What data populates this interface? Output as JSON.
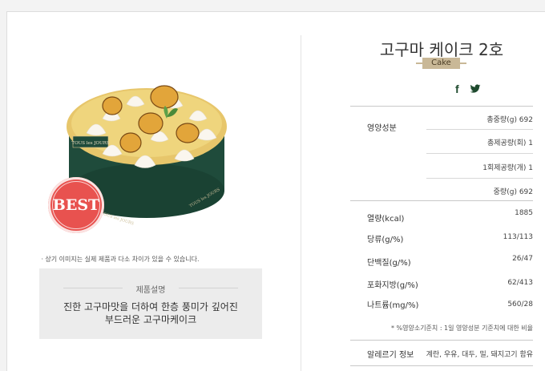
{
  "product": {
    "name": "고구마 케이크 2호",
    "category": "Cake",
    "badge": "BEST",
    "brand_box": "TOUS les JOURS",
    "image_notice": "ㆍ상기 이미지는 실제 제품과 다소 차이가 있을 수 있습니다.",
    "description_title": "제품설명",
    "description_line1": "진한 고구마맛을 더하여 한층 풍미가 깊어진",
    "description_line2": "부드러운 고구마케이크"
  },
  "share": {
    "facebook_icon": "facebook-icon",
    "twitter_icon": "twitter-icon"
  },
  "nutrition": {
    "section_label": "영양성분",
    "total_weight": "총중량(g) 692",
    "servings": "총제공량(회) 1",
    "serving_size": "1회제공량(개) 1",
    "weight": "중량(g) 692",
    "rows": [
      {
        "label": "열량(kcal)",
        "value": "1885"
      },
      {
        "label": "당류(g/%)",
        "value": "113/113"
      },
      {
        "label": "단백질(g/%)",
        "value": "26/47"
      },
      {
        "label": "포화지방(g/%)",
        "value": "62/413"
      },
      {
        "label": "나트륨(mg/%)",
        "value": "560/28"
      }
    ],
    "footnote": "* %영양소기준치 : 1일 영양성분 기준치에 대한 비율",
    "allergy_label": "알레르기 정보",
    "allergy_value": "계란, 우유, 대두, 밀, 돼지고기 함유"
  },
  "colors": {
    "accent": "#c9b897",
    "badge": "#e8524f",
    "cake_band": "#1f4b3b"
  }
}
